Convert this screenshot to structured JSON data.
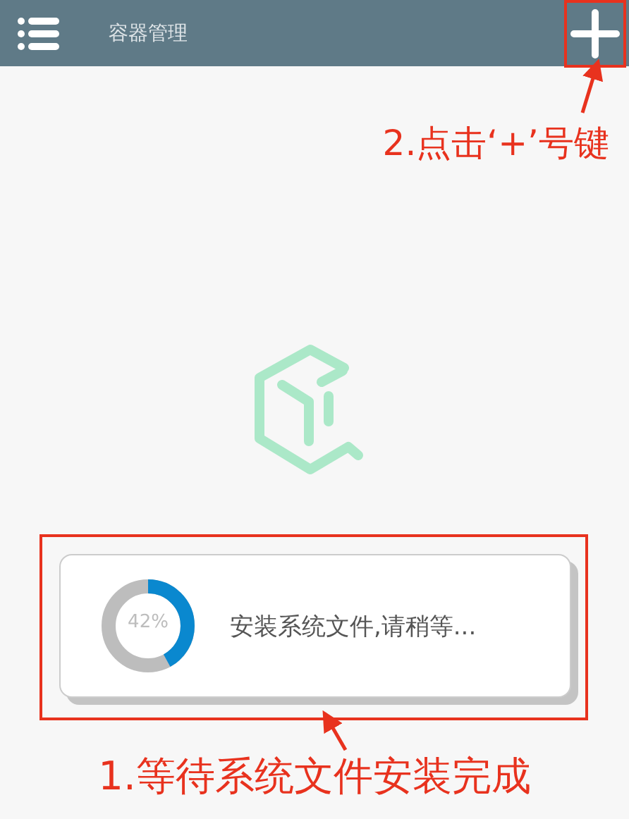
{
  "app_bar": {
    "title": "容器管理"
  },
  "add_hint": {
    "text": "2.点击‘+’号键"
  },
  "progress": {
    "level": 0.42,
    "reading": "42%",
    "message": "安装系统文件,请稍等..."
  },
  "wait_hint": {
    "text": "1.等待系统文件安装完成"
  }
}
